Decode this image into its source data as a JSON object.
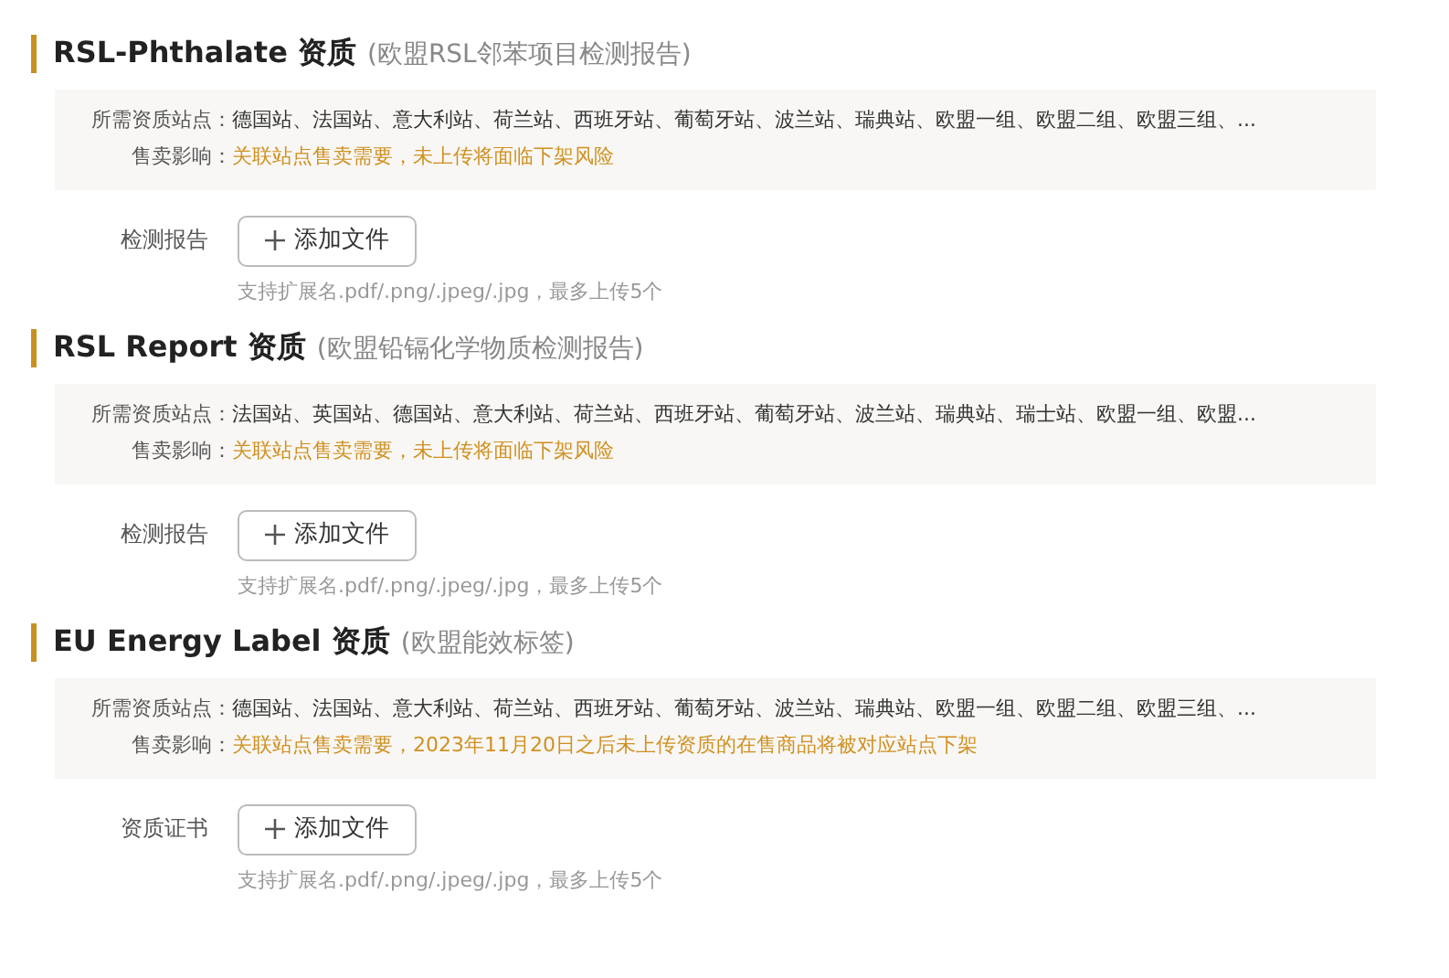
{
  "sections": [
    {
      "title": "RSL-Phthalate 资质",
      "subtitle": "(欧盟RSL邻苯项目检测报告)",
      "sites_label": "所需资质站点：",
      "sites": "德国站、法国站、意大利站、荷兰站、西班牙站、葡萄牙站、波兰站、瑞典站、欧盟一组、欧盟二组、欧盟三组、...",
      "impact_label": "售卖影响：",
      "impact": "关联站点售卖需要，未上传将面临下架风险",
      "field_label": "检测报告",
      "button": "添加文件",
      "hint": "支持扩展名.pdf/.png/.jpeg/.jpg，最多上传5个"
    },
    {
      "title": "RSL Report 资质",
      "subtitle": "(欧盟铅镉化学物质检测报告)",
      "sites_label": "所需资质站点：",
      "sites": "法国站、英国站、德国站、意大利站、荷兰站、西班牙站、葡萄牙站、波兰站、瑞典站、瑞士站、欧盟一组、欧盟...",
      "impact_label": "售卖影响：",
      "impact": "关联站点售卖需要，未上传将面临下架风险",
      "field_label": "检测报告",
      "button": "添加文件",
      "hint": "支持扩展名.pdf/.png/.jpeg/.jpg，最多上传5个"
    },
    {
      "title": "EU Energy Label 资质",
      "subtitle": "(欧盟能效标签)",
      "sites_label": "所需资质站点：",
      "sites": "德国站、法国站、意大利站、荷兰站、西班牙站、葡萄牙站、波兰站、瑞典站、欧盟一组、欧盟二组、欧盟三组、...",
      "impact_label": "售卖影响：",
      "impact": "关联站点售卖需要，2023年11月20日之后未上传资质的在售商品将被对应站点下架",
      "field_label": "资质证书",
      "button": "添加文件",
      "hint": "支持扩展名.pdf/.png/.jpeg/.jpg，最多上传5个"
    }
  ]
}
